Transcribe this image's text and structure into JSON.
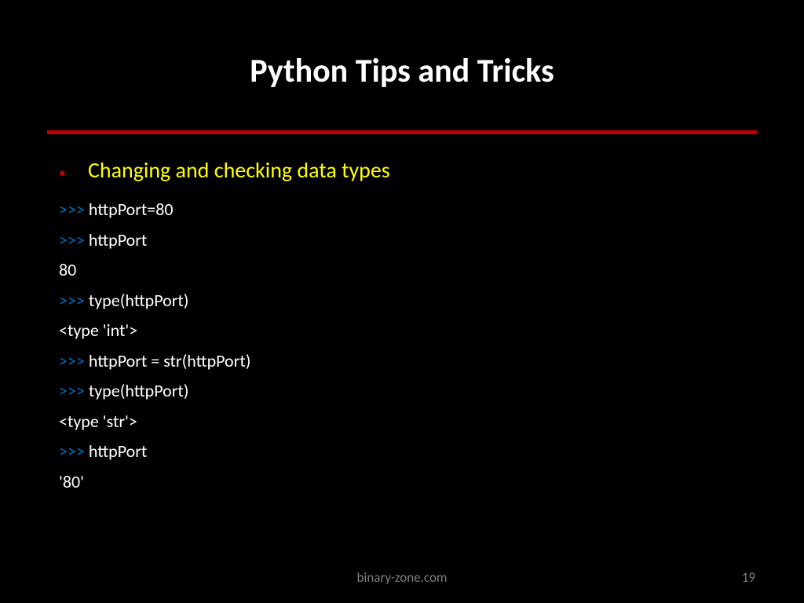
{
  "title": "Python Tips and Tricks",
  "topic": "Changing and checking data types",
  "prompt": ">>>",
  "lines": {
    "l1": "httpPort=80",
    "l2": "httpPort",
    "l3": "80",
    "l4": "type(httpPort)",
    "l5": "<type 'int'>",
    "l6": "httpPort = str(httpPort)",
    "l7": "type(httpPort)",
    "l8": "<type 'str'>",
    "l9": "httpPort",
    "l10": "'80'"
  },
  "footer": {
    "site": "binary-zone.com",
    "page": "19"
  }
}
